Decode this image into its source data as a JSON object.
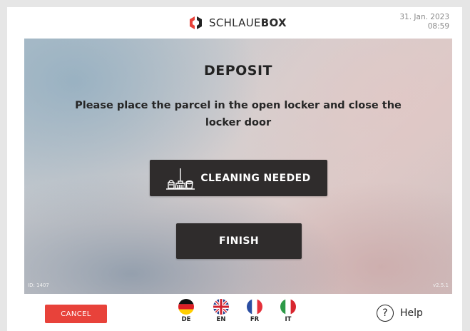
{
  "header": {
    "brand_light": "SCHLAUE",
    "brand_bold": "BOX",
    "date": "31. Jan. 2023",
    "time": "08:59"
  },
  "main": {
    "title": "DEPOSIT",
    "message": "Please place the parcel in the open locker and close the locker door",
    "cleaning_button": "CLEANING NEEDED",
    "finish_button": "FINISH",
    "id_label": "ID: 1407",
    "version": "v2.5.1"
  },
  "footer": {
    "cancel": "CANCEL",
    "languages": [
      {
        "code": "DE",
        "icon": "german-flag-icon"
      },
      {
        "code": "EN",
        "icon": "uk-flag-icon"
      },
      {
        "code": "FR",
        "icon": "french-flag-icon"
      },
      {
        "code": "IT",
        "icon": "italian-flag-icon"
      }
    ],
    "help": "Help"
  },
  "colors": {
    "cancel_red": "#e8423a",
    "button_dark": "#2f2c2c",
    "logo_red": "#e8423a"
  }
}
